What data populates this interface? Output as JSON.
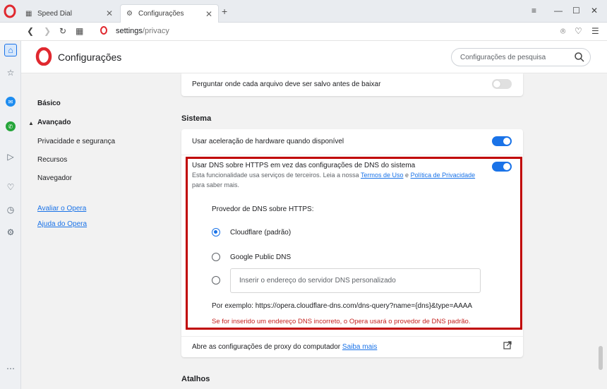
{
  "tabs": [
    {
      "label": "Speed Dial",
      "icon": "grid-icon"
    },
    {
      "label": "Configurações",
      "icon": "gear-icon"
    }
  ],
  "address": {
    "host": "settings",
    "path": "/privacy"
  },
  "header": {
    "title": "Configurações",
    "search_placeholder": "Configurações de pesquisa"
  },
  "settings_nav": {
    "basic": "Básico",
    "advanced": "Avançado",
    "privacy": "Privacidade e segurança",
    "features": "Recursos",
    "browser": "Navegador",
    "rate": "Avaliar o Opera",
    "help": "Ajuda do Opera"
  },
  "main": {
    "ask_download": "Perguntar onde cada arquivo deve ser salvo antes de baixar",
    "ask_download_enabled": false,
    "system_title": "Sistema",
    "hw_accel": "Usar aceleração de hardware quando disponível",
    "hw_accel_enabled": true,
    "dns": {
      "title": "Usar DNS sobre HTTPS em vez das configurações de DNS do sistema",
      "enabled": true,
      "desc_prefix": "Esta funcionalidade usa serviços de terceiros. Leia a nossa",
      "terms_link": "Termos de Uso",
      "and": "e",
      "privacy_link": "Política de Privacidade",
      "desc_suffix": "para saber mais.",
      "provider_label": "Provedor de DNS sobre HTTPS:",
      "options": [
        "Cloudflare (padrão)",
        "Google Public DNS"
      ],
      "selected": "Cloudflare (padrão)",
      "custom_placeholder": "Inserir o endereço do servidor DNS personalizado",
      "example": "Por exemplo: https://opera.cloudflare-dns.com/dns-query?name={dns}&type=AAAA",
      "warning": "Se for inserido um endereço DNS incorreto, o Opera usará o provedor de DNS padrão."
    },
    "proxy_text": "Abre as configurações de proxy do computador",
    "proxy_link": "Saiba mais",
    "shortcuts_title": "Atalhos"
  },
  "colors": {
    "accent": "#1a73e8",
    "highlight_border": "#c00000",
    "warning": "#c5221f",
    "opera_red": "#e0282f"
  }
}
